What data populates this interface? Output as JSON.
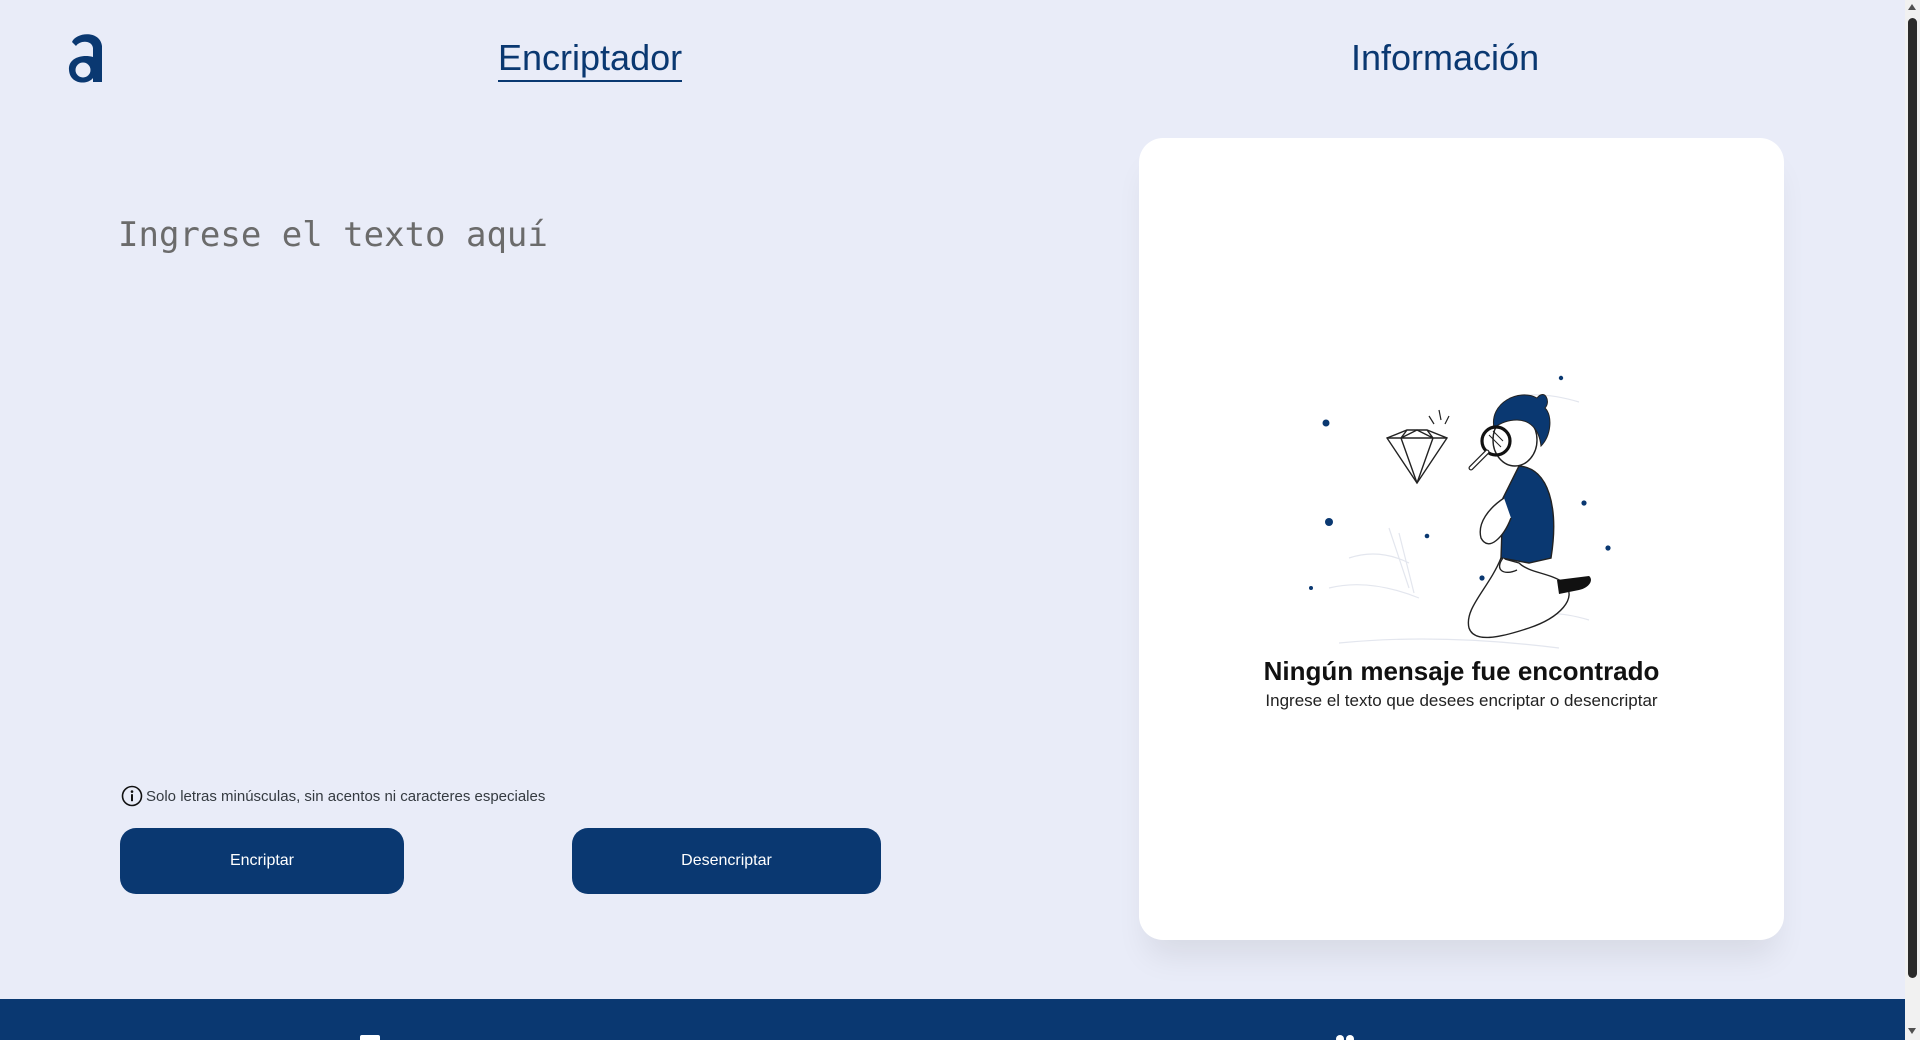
{
  "header": {
    "logo_icon": "alura-a-logo-icon",
    "nav": {
      "encriptador_label": "Encriptador",
      "informacion_label": "Información"
    }
  },
  "input": {
    "placeholder": "Ingrese el texto aquí",
    "value": ""
  },
  "hint": {
    "icon": "info-icon",
    "text": "Solo letras minúsculas, sin acentos ni caracteres especiales"
  },
  "actions": {
    "encrypt_label": "Encriptar",
    "decrypt_label": "Desencriptar"
  },
  "output": {
    "illustration": "person-with-magnifying-glass-and-diamond",
    "title": "Ningún mensaje fue encontrado",
    "subtitle": "Ingrese el texto que desees encriptar o desencriptar"
  },
  "colors": {
    "background": "#e9ecf8",
    "primary": "#0a3871",
    "card": "#ffffff"
  }
}
